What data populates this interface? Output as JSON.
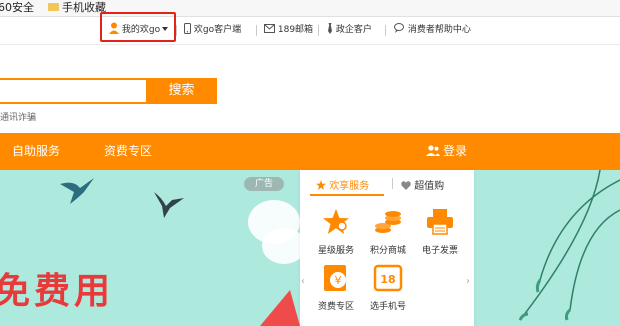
{
  "bookmarks": {
    "item1": "60安全",
    "item2": "手机收藏"
  },
  "topnav": {
    "my": "我的欢go",
    "client": "欢go客户端",
    "mail": "189邮箱",
    "enterprise": "政企客户",
    "help": "消费者帮助中心"
  },
  "search": {
    "button": "搜索",
    "placeholder": ""
  },
  "fraud_text": "通讯诈骗",
  "orange_nav": {
    "self_service": "自助服务",
    "tariff_zone": "资费专区",
    "login": "登录"
  },
  "banner": {
    "ad_label": "广告",
    "promo_text": "免费用"
  },
  "panel": {
    "tab_active": "欢享服务",
    "tab_other": "超值购",
    "items": [
      {
        "label": "星级服务",
        "icon": "star-icon"
      },
      {
        "label": "积分商城",
        "icon": "coins-icon"
      },
      {
        "label": "电子发票",
        "icon": "printer-icon"
      },
      {
        "label": "资费专区",
        "icon": "yen-icon"
      },
      {
        "label": "选手机号",
        "icon": "phone-number-icon"
      }
    ]
  },
  "colors": {
    "brand_orange": "#ff8a00",
    "highlight_red": "#e2231a",
    "banner_bg": "#aee9dd"
  }
}
